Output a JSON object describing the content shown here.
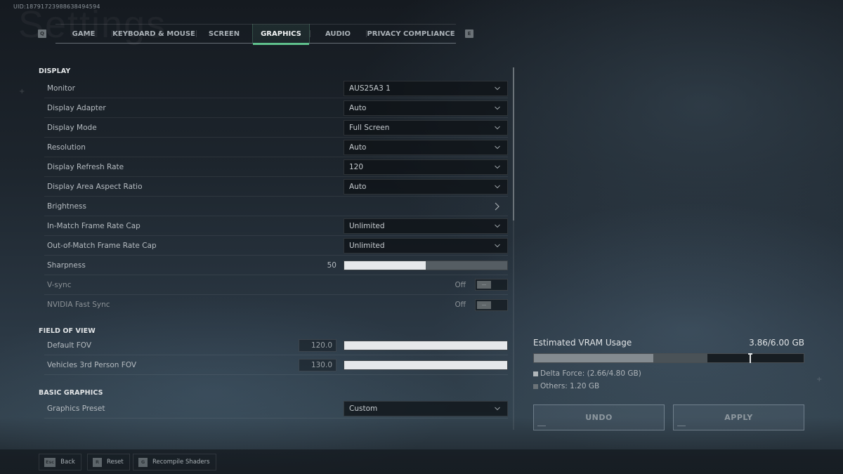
{
  "uid_text": "UID:18791723988638494594",
  "watermark_title": "Settings",
  "tabbar": {
    "prev_key": "Q",
    "next_key": "E",
    "tabs": [
      {
        "label": "GAME",
        "active": false
      },
      {
        "label": "KEYBOARD & MOUSE",
        "active": false
      },
      {
        "label": "SCREEN",
        "active": false
      },
      {
        "label": "GRAPHICS",
        "active": true
      },
      {
        "label": "AUDIO",
        "active": false
      },
      {
        "label": "PRIVACY COMPLIANCE",
        "active": false
      }
    ]
  },
  "sections": {
    "display": {
      "title": "DISPLAY",
      "monitor": {
        "label": "Monitor",
        "value": "AUS25A3 1"
      },
      "display_adapter": {
        "label": "Display Adapter",
        "value": "Auto"
      },
      "display_mode": {
        "label": "Display Mode",
        "value": "Full Screen"
      },
      "resolution": {
        "label": "Resolution",
        "value": "Auto"
      },
      "refresh_rate": {
        "label": "Display Refresh Rate",
        "value": "120"
      },
      "aspect_ratio": {
        "label": "Display Area Aspect Ratio",
        "value": "Auto"
      },
      "brightness": {
        "label": "Brightness"
      },
      "in_match_cap": {
        "label": "In-Match Frame Rate Cap",
        "value": "Unlimited"
      },
      "out_match_cap": {
        "label": "Out-of-Match Frame Rate Cap",
        "value": "Unlimited"
      },
      "sharpness": {
        "label": "Sharpness",
        "value": "50",
        "fraction": 0.5
      },
      "vsync": {
        "label": "V-sync",
        "state": "Off"
      },
      "nvidia_fast_sync": {
        "label": "NVIDIA Fast Sync",
        "state": "Off"
      }
    },
    "fov": {
      "title": "FIELD OF VIEW",
      "default_fov": {
        "label": "Default FOV",
        "value": "120.0",
        "fraction": 1.0
      },
      "vehicle_fov": {
        "label": "Vehicles 3rd Person FOV",
        "value": "130.0",
        "fraction": 1.0
      }
    },
    "basic_graphics": {
      "title": "BASIC GRAPHICS",
      "preset": {
        "label": "Graphics Preset",
        "value": "Custom"
      }
    }
  },
  "vram": {
    "title": "Estimated VRAM Usage",
    "total_text": "3.86/6.00 GB",
    "total_gb": 6.0,
    "used_gb": 3.86,
    "delta_force_gb": 2.66,
    "delta_force_budget_gb": 4.8,
    "others_gb": 1.2,
    "legend_delta": "Delta Force: (2.66/4.80 GB)",
    "legend_others": "Others: 1.20 GB",
    "colors": {
      "delta": "#848b90",
      "others": "#4a5257"
    }
  },
  "actions": {
    "undo": "UNDO",
    "apply": "APPLY"
  },
  "footer": {
    "back": {
      "key": "Esc",
      "label": "Back"
    },
    "reset": {
      "key": "R",
      "label": "Reset"
    },
    "recompile": {
      "key": "G",
      "label": "Recompile Shaders"
    }
  },
  "colors": {
    "accent": "#5fc08c"
  }
}
